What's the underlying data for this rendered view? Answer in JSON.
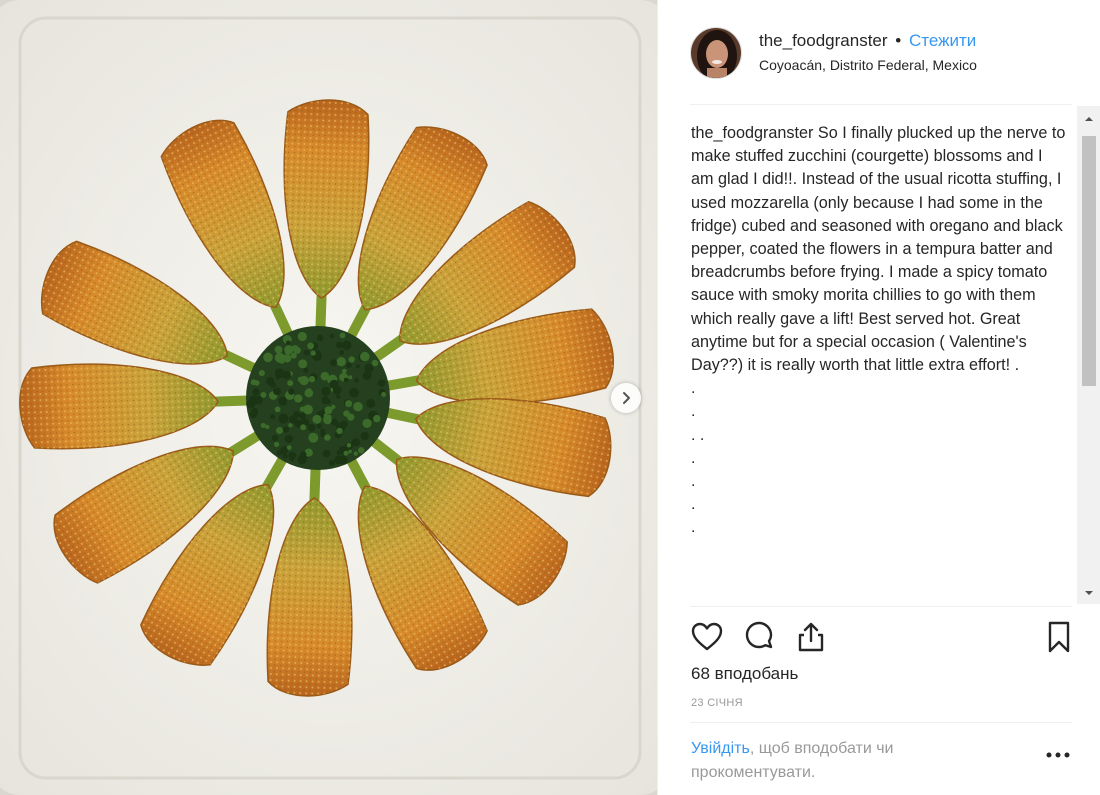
{
  "post": {
    "username": "the_foodgranster",
    "separator": "•",
    "follow_label": "Стежити",
    "location": "Coyoacán, Distrito Federal, Mexico"
  },
  "caption": {
    "user": "the_foodgranster",
    "text": "So I finally plucked up the nerve to make stuffed zucchini (courgette) blossoms and I am glad I did!!. Instead of the usual ricotta stuffing, I used mozzarella (only because I had some in the fridge) cubed and seasoned with oregano and black pepper, coated the flowers in a tempura batter and breadcrumbs before frying. I made a spicy tomato sauce with smoky morita chillies to go with them which really gave a lift! Best served hot. Great anytime but for a special occasion ( Valentine's Day??) it is really worth that little extra effort! .",
    "dot_lines": [
      ".",
      ".",
      ". .",
      ".",
      ".",
      ".",
      "."
    ]
  },
  "actions": {
    "like_icon": "heart-icon",
    "comment_icon": "comment-icon",
    "share_icon": "share-icon",
    "save_icon": "bookmark-icon"
  },
  "likes_label": "68 вподобань",
  "date_label": "23 СІЧНЯ",
  "login_prompt": {
    "link": "Увійдіть",
    "text": ", щоб вподобати чи прокоментувати."
  },
  "more_icon": "more-horizontal-icon",
  "colors": {
    "link": "#3897f0",
    "muted": "#999999",
    "text": "#262626"
  }
}
